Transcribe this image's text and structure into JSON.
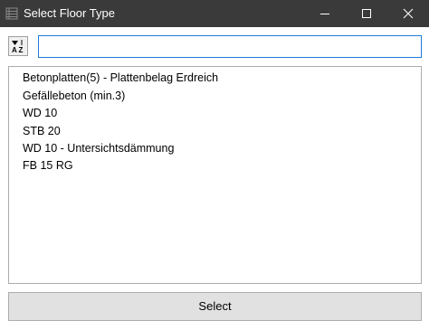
{
  "window": {
    "title": "Select Floor Type",
    "title_bar_color": "#3a3a3a",
    "icons": {
      "app": "list-icon",
      "minimize": "minimize-icon",
      "maximize": "maximize-icon",
      "close": "close-icon"
    }
  },
  "toolbar": {
    "sort_icon": "sort-az-icon",
    "search": {
      "value": "",
      "placeholder": ""
    },
    "focus_color": "#1e7bd8"
  },
  "list": {
    "items": [
      "Betonplatten(5) - Plattenbelag Erdreich",
      "Gefällebeton (min.3)",
      "WD 10",
      "STB 20",
      "WD 10 - Untersichtsdämmung",
      "FB 15 RG"
    ]
  },
  "footer": {
    "select_label": "Select"
  }
}
